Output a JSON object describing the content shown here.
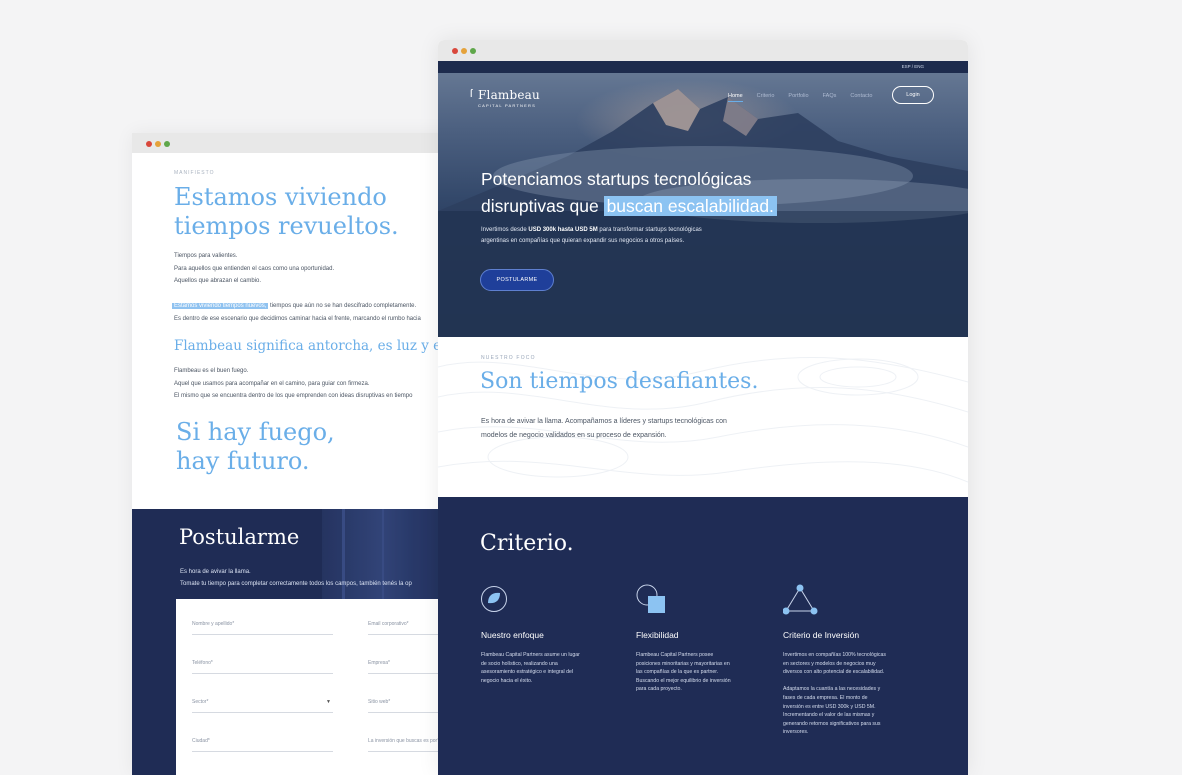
{
  "back_window": {
    "eyebrow": "MANIFIESTO",
    "headline_1": "Estamos viviendo",
    "headline_2": "tiempos revueltos.",
    "lines_1": [
      "Tiempos para valientes.",
      "Para aquellos que entienden el caos como una oportunidad.",
      "Aquellos que abrazan el cambio."
    ],
    "highlight": "Estamos viviendo tiempos nuevos,",
    "line_after_highlight": " tiempos que aún no se han descifrado completamente.",
    "line_2b": "Es dentro de ese escenario que decidimos caminar hacia el frente, marcando el rumbo hacia",
    "subheadline": "Flambeau significa antorcha, es luz y es fla",
    "lines_2": [
      "Flambeau es el buen fuego.",
      "Aquel que usamos para acompañar en el camino, para guiar con firmeza.",
      "El mismo que se encuentra dentro de los que emprenden con ideas disruptivas en tiempo"
    ],
    "fire_1": "Si hay fuego,",
    "fire_2": "hay futuro.",
    "apply": {
      "title": "Postularme",
      "line_1": "Es hora de avivar la llama.",
      "line_2": "Tomate tu tiempo para completar correctamente todos los campos, también tenés la op",
      "fields": {
        "name": "Nombre y apellido*",
        "email": "Email corporativo*",
        "phone": "Teléfono*",
        "company": "Empresa*",
        "sector": "Sector*",
        "website": "Sitio web*",
        "city": "Ciudad*",
        "investment": "La inversión que buscas es por*"
      }
    }
  },
  "front_window": {
    "lang": "ESP / ENG",
    "logo": {
      "name": "Flambeau",
      "tagline": "CAPITAL PARTNERS"
    },
    "nav": [
      "Home",
      "Criterio",
      "Portfolio",
      "FAQs",
      "Contacto"
    ],
    "login": "Login",
    "hero": {
      "title_1": "Potenciamos startups tecnológicas",
      "title_2a": "disruptivas que ",
      "title_2b": "buscan escalabilidad.",
      "sub_1a": "Invertimos desde ",
      "sub_1b": "USD 300k hasta USD 5M",
      "sub_1c": " para transformar startups tecnológicas",
      "sub_2": "argentinas en compañías que quieran expandir sus negocios a otros países.",
      "cta": "POSTULARME"
    },
    "focus": {
      "eyebrow": "NUESTRO FOCO",
      "title": "Son tiempos desafiantes.",
      "text_1": "Es hora de avivar la llama. Acompañamos a líderes y startups tecnológicas con",
      "text_2": "modelos de negocio validados en su proceso de expansión."
    },
    "criteria": {
      "title": "Criterio.",
      "columns": [
        {
          "title": "Nuestro enfoque",
          "text": "Flambeau Capital Partners asume un lugar\nde socio holístico, realizando una\nasesoramiento estratégico e integral del\nnegocio hacia el éxito."
        },
        {
          "title": "Flexibilidad",
          "text": "Flambeau Capital Partners posee\nposiciones minoritarias y mayoritarias en\nlas compañías de la que es partner.\nBuscando el mejor equilibrio de inversión\npara cada proyecto."
        },
        {
          "title": "Criterio de Inversión",
          "text": "Invertimos en compañías 100% tecnológicas\nen sectores y modelos de negocios muy\ndiversos con alto potencial de escalabilidad.\n\nAdaptamos la cuantía a las necesidades y\nfases de cada empresa. El monto de\ninversión es entre USD 300k y USD 5M.\nIncrementando el valor de las mismas y\ngenerando retornos significativos para sus\ninversores."
        }
      ]
    }
  },
  "colors": {
    "accent": "#6aaee8",
    "navy": "#1f2c55",
    "button": "#1f3f9a"
  }
}
